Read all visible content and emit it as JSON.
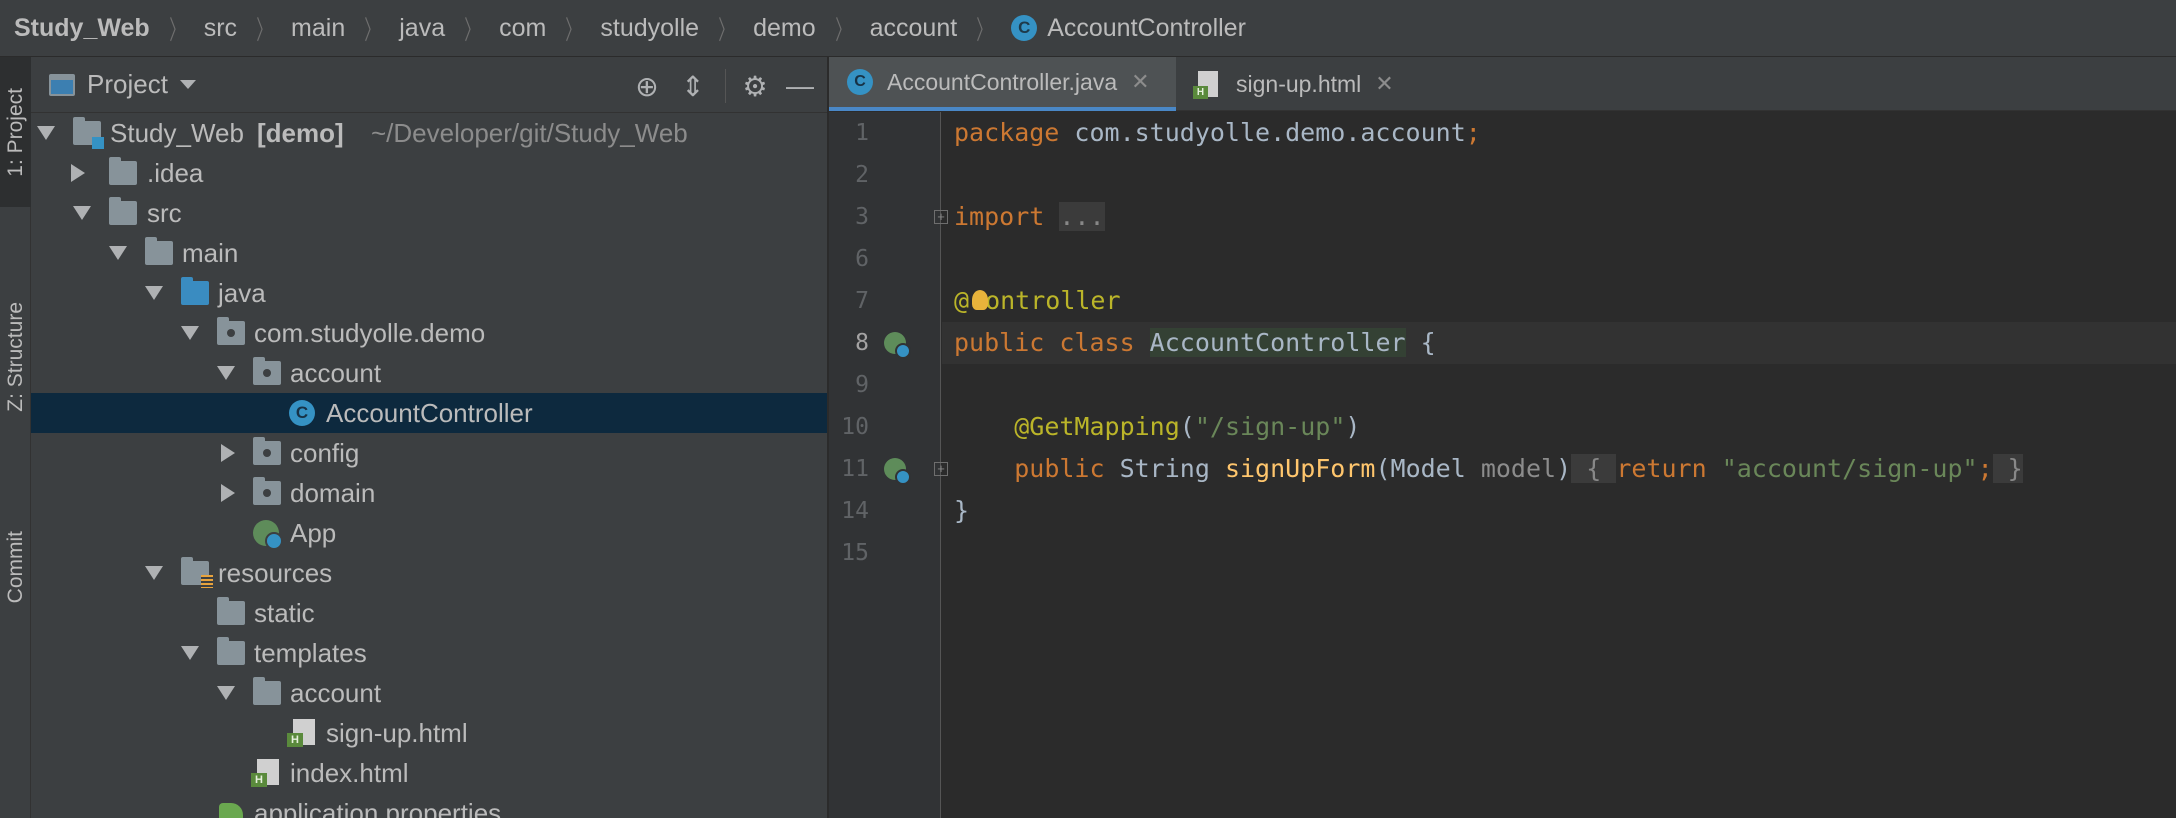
{
  "breadcrumb": {
    "items": [
      "Study_Web",
      "src",
      "main",
      "java",
      "com",
      "studyolle",
      "demo",
      "account",
      "AccountController"
    ]
  },
  "toolstrip": {
    "project_tab": "1: Project",
    "structure_tab": "Z: Structure",
    "commit_tab": "Commit"
  },
  "project_panel": {
    "title": "Project",
    "tree": [
      {
        "label": "Study_Web",
        "suffix_bold": "[demo]",
        "suffix_dim": "~/Developer/git/Study_Web"
      },
      {
        "label": ".idea"
      },
      {
        "label": "src"
      },
      {
        "label": "main"
      },
      {
        "label": "java"
      },
      {
        "label": "com.studyolle.demo"
      },
      {
        "label": "account"
      },
      {
        "label": "AccountController"
      },
      {
        "label": "config"
      },
      {
        "label": "domain"
      },
      {
        "label": "App"
      },
      {
        "label": "resources"
      },
      {
        "label": "static"
      },
      {
        "label": "templates"
      },
      {
        "label": "account"
      },
      {
        "label": "sign-up.html"
      },
      {
        "label": "index.html"
      },
      {
        "label": "application.properties"
      }
    ]
  },
  "editor": {
    "tabs": [
      {
        "label": "AccountController.java",
        "active": true
      },
      {
        "label": "sign-up.html",
        "active": false
      }
    ],
    "line_numbers": [
      "1",
      "2",
      "3",
      "6",
      "7",
      "8",
      "9",
      "10",
      "11",
      "14",
      "15"
    ],
    "code": {
      "l1_kw": "package",
      "l1_rest": " com.studyolle.demo.account",
      "l1_semi": ";",
      "l3_kw": "import",
      "l3_fold": "...",
      "l7_at": "@",
      "l7_name": "ontroller",
      "l8_kw": "public class ",
      "l8_cls": "AccountController",
      "l8_rest": " {",
      "l10_ann": "@GetMapping",
      "l10_open": "(",
      "l10_str": "\"/sign-up\"",
      "l10_close": ")",
      "l11_kw": "public",
      "l11_type": " String ",
      "l11_fn": "signUpForm",
      "l11_params_open": "(Model ",
      "l11_param": "model",
      "l11_params_close": ")",
      "l11_fold_open": " { ",
      "l11_return": "return",
      "l11_str": "\"account/sign-up\"",
      "l11_semi": ";",
      "l11_fold_close": " }",
      "l14": "}"
    }
  },
  "colors": {
    "keyword": "#cc7832",
    "annotation": "#bbb529",
    "string": "#6a8759",
    "function": "#ffc66d",
    "selection": "#0d293e",
    "tab_underline": "#4a88c7"
  }
}
